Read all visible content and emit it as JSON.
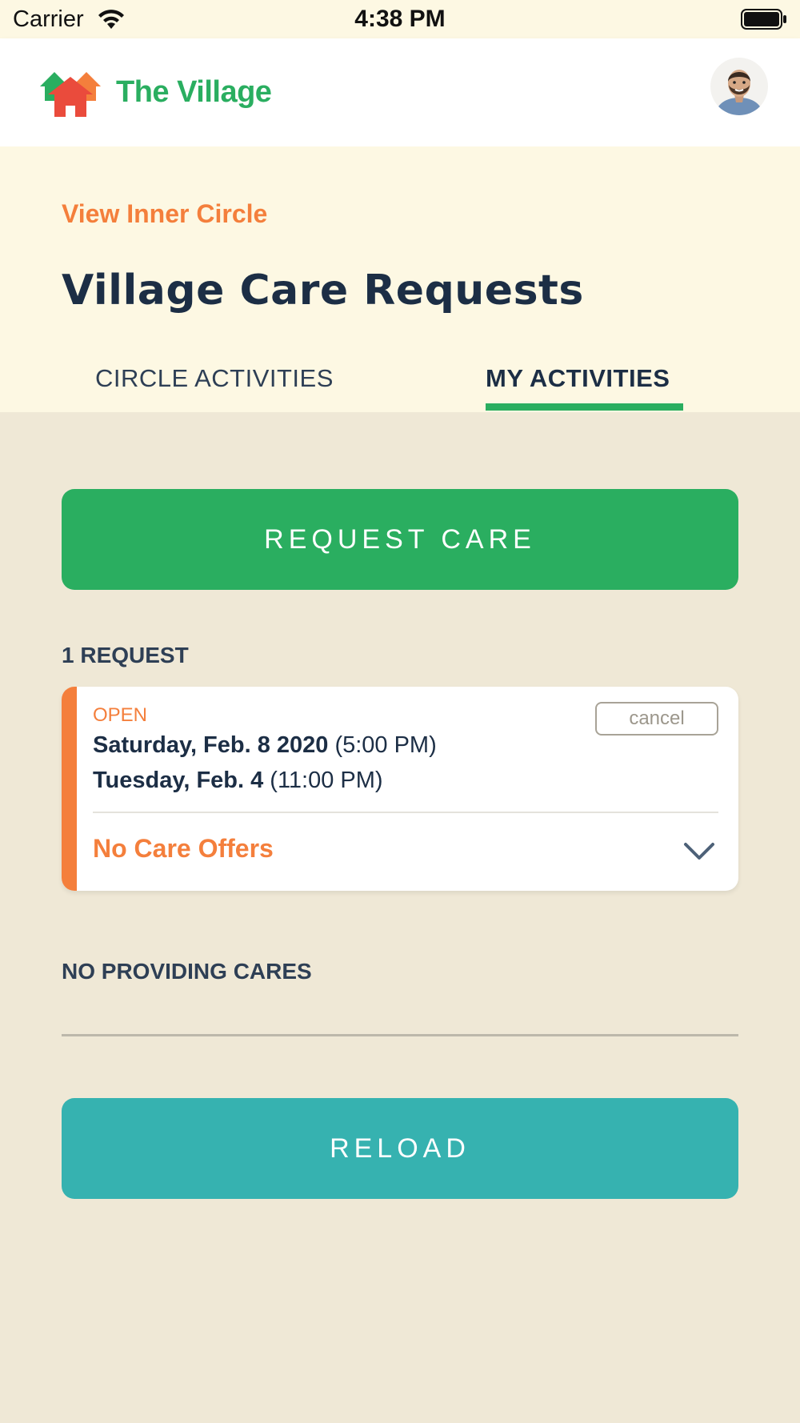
{
  "status_bar": {
    "carrier": "Carrier",
    "time": "4:38 PM",
    "wifi_icon": "wifi-icon",
    "battery_icon": "battery-icon"
  },
  "header": {
    "app_title": "The Village",
    "logo_icon": "village-houses-logo",
    "avatar_icon": "user-avatar"
  },
  "top": {
    "inner_circle_link": "View Inner Circle",
    "page_title": "Village Care Requests",
    "tabs": [
      {
        "label": "CIRCLE ACTIVITIES",
        "active": false
      },
      {
        "label": "MY ACTIVITIES",
        "active": true
      }
    ]
  },
  "request_care_button": "REQUEST CARE",
  "requests": {
    "count_label": "1 REQUEST",
    "items": [
      {
        "status": "OPEN",
        "cancel_label": "cancel",
        "date1": "Saturday, Feb. 8 2020",
        "time1": "(5:00 PM)",
        "date2": "Tuesday, Feb. 4",
        "time2": "(11:00 PM)",
        "offers_label": "No Care Offers",
        "expand_icon": "chevron-down-icon"
      }
    ]
  },
  "providing_label": "NO PROVIDING CARES",
  "reload_button": "RELOAD",
  "colors": {
    "green": "#2aae60",
    "orange": "#f47f3c",
    "teal": "#36b2b0",
    "navy": "#1c2e45",
    "background": "#efe8d6",
    "cream": "#fdf8e3"
  }
}
